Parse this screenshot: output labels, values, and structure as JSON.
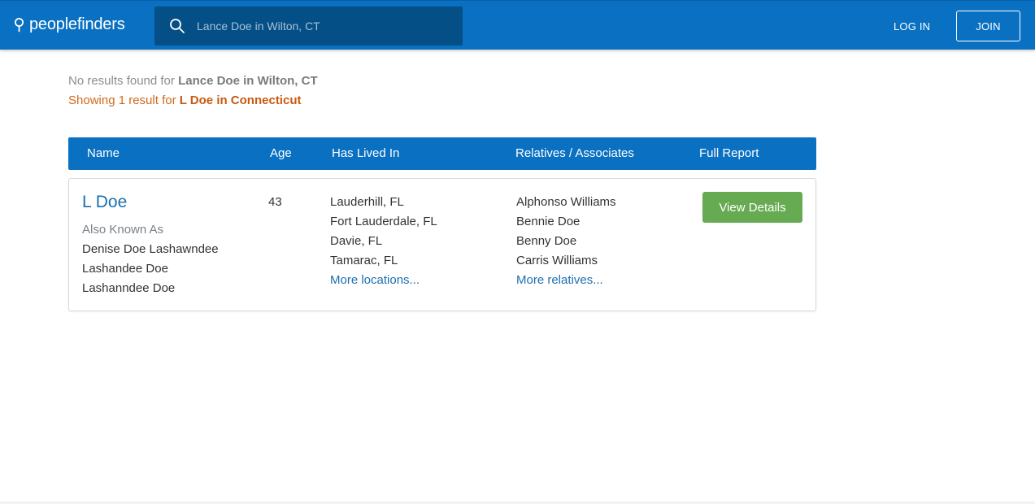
{
  "header": {
    "brand": "peoplefinders",
    "search_placeholder": "Lance Doe in Wilton, CT",
    "login_label": "LOG IN",
    "join_label": "JOIN",
    "colors": {
      "bar": "#0a70c1",
      "search_bg": "#044f86"
    }
  },
  "messages": {
    "none_prefix": "No results found for ",
    "none_query": "Lance Doe in Wilton, CT",
    "showing_prefix": "Showing 1 result for ",
    "showing_query": "L Doe in Connecticut"
  },
  "table": {
    "headers": [
      "Name",
      "Age",
      "Has Lived In",
      "Relatives / Associates",
      "Full Report"
    ]
  },
  "result": {
    "name": "L Doe",
    "age": "43",
    "aka_label": "Also Known As",
    "aliases": [
      "Denise Doe Lashawndee",
      "Lashandee Doe",
      "Lashanndee Doe"
    ],
    "locations": [
      "Lauderhill, FL",
      "Fort Lauderdale, FL",
      "Davie, FL",
      "Tamarac, FL"
    ],
    "more_locations": "More locations...",
    "relatives": [
      "Alphonso Williams",
      "Bennie Doe",
      "Benny Doe",
      "Carris Williams"
    ],
    "more_relatives": "More relatives...",
    "view_details": "View Details",
    "colors": {
      "link": "#1c6fb0",
      "button": "#66aa52",
      "highlight": "#d2691e"
    }
  }
}
